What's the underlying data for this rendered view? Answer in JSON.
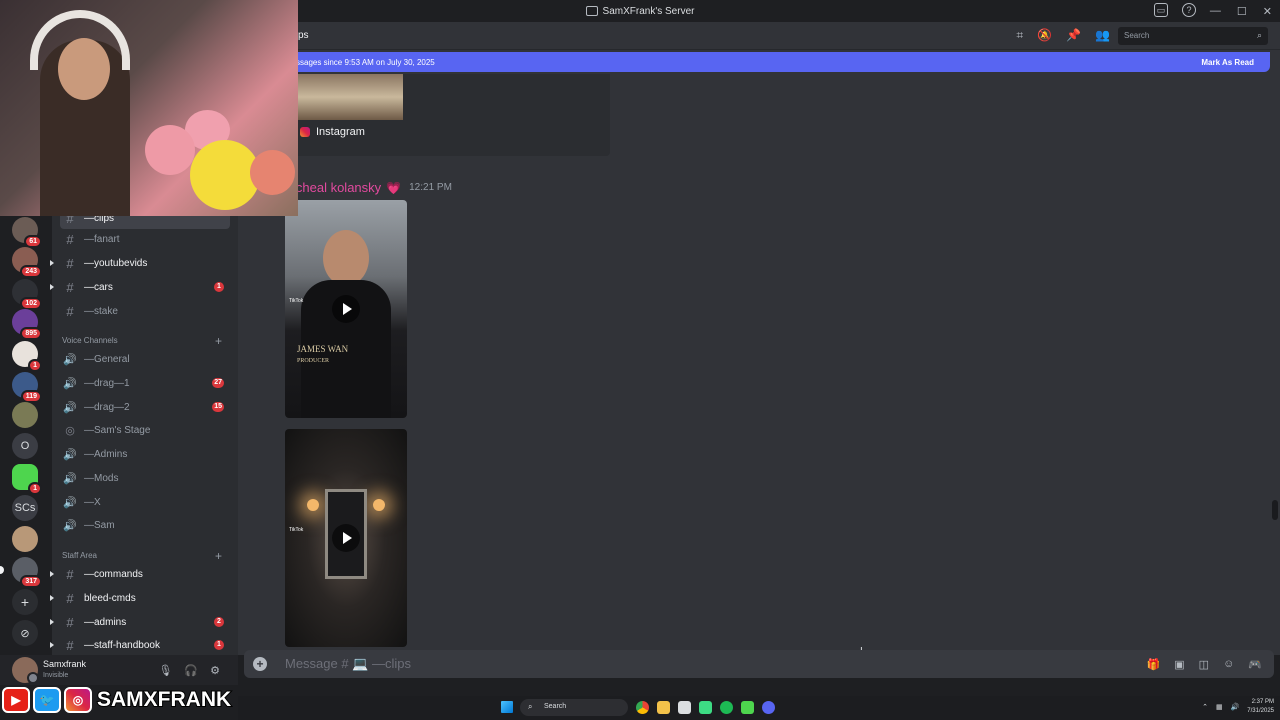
{
  "window": {
    "title": "SamXFrank's Server",
    "minimize": "—",
    "maximize": "☐",
    "close": "✕"
  },
  "header": {
    "channel_name": "ps",
    "search_placeholder": "Search"
  },
  "new_messages_bar": {
    "text": "ssages since 9:53 AM on July 30, 2025",
    "action": "Mark As Read"
  },
  "embed": {
    "source": "Instagram"
  },
  "message": {
    "author": "icheal kolansky",
    "time": "12:21 PM",
    "video1_caption_name": "JAMES WAN",
    "video1_caption_role": "PRODUCER",
    "tiktok_label": "TikTok"
  },
  "servers": [
    {
      "label": "",
      "badge": "61"
    },
    {
      "label": "",
      "badge": "243"
    },
    {
      "label": "",
      "badge": "102"
    },
    {
      "label": "",
      "badge": "895"
    },
    {
      "label": "",
      "badge": "1"
    },
    {
      "label": "",
      "badge": "119"
    },
    {
      "label": "",
      "badge": ""
    },
    {
      "label": "O",
      "badge": ""
    },
    {
      "label": "",
      "badge": "1"
    },
    {
      "label": "SCs",
      "badge": ""
    },
    {
      "label": "",
      "badge": ""
    },
    {
      "label": "",
      "badge": "317"
    },
    {
      "label": "+",
      "badge": ""
    },
    {
      "label": "⊘",
      "badge": ""
    }
  ],
  "channels": {
    "clips": "—clips",
    "fanart": "—fanart",
    "youtubevids": "—youtubevids",
    "cars": "—cars",
    "cars_badge": "1",
    "stake": "—stake",
    "voice_category": "Voice Channels",
    "general": "—General",
    "drag1": "—drag—1",
    "drag1_badge": "27",
    "drag2": "—drag—2",
    "drag2_badge": "15",
    "sams_stage": "—Sam's Stage",
    "admins_voice": "—Admins",
    "mods": "—Mods",
    "x": "—X",
    "sam": "—Sam",
    "staff_category": "Staff Area",
    "commands": "—commands",
    "bleed_cmds": "bleed-cmds",
    "admins": "—admins",
    "admins_badge": "2",
    "staff_handbook": "—staff-handbook",
    "staff_handbook_badge": "1"
  },
  "user": {
    "name": "Samxfrank",
    "status": "Invisible"
  },
  "composer": {
    "placeholder": "Message # 💻 —clips"
  },
  "branding": {
    "handle": "SAMXFRANK"
  },
  "taskbar": {
    "search": "Search",
    "time": "2:37 PM",
    "date": "7/31/2025"
  }
}
